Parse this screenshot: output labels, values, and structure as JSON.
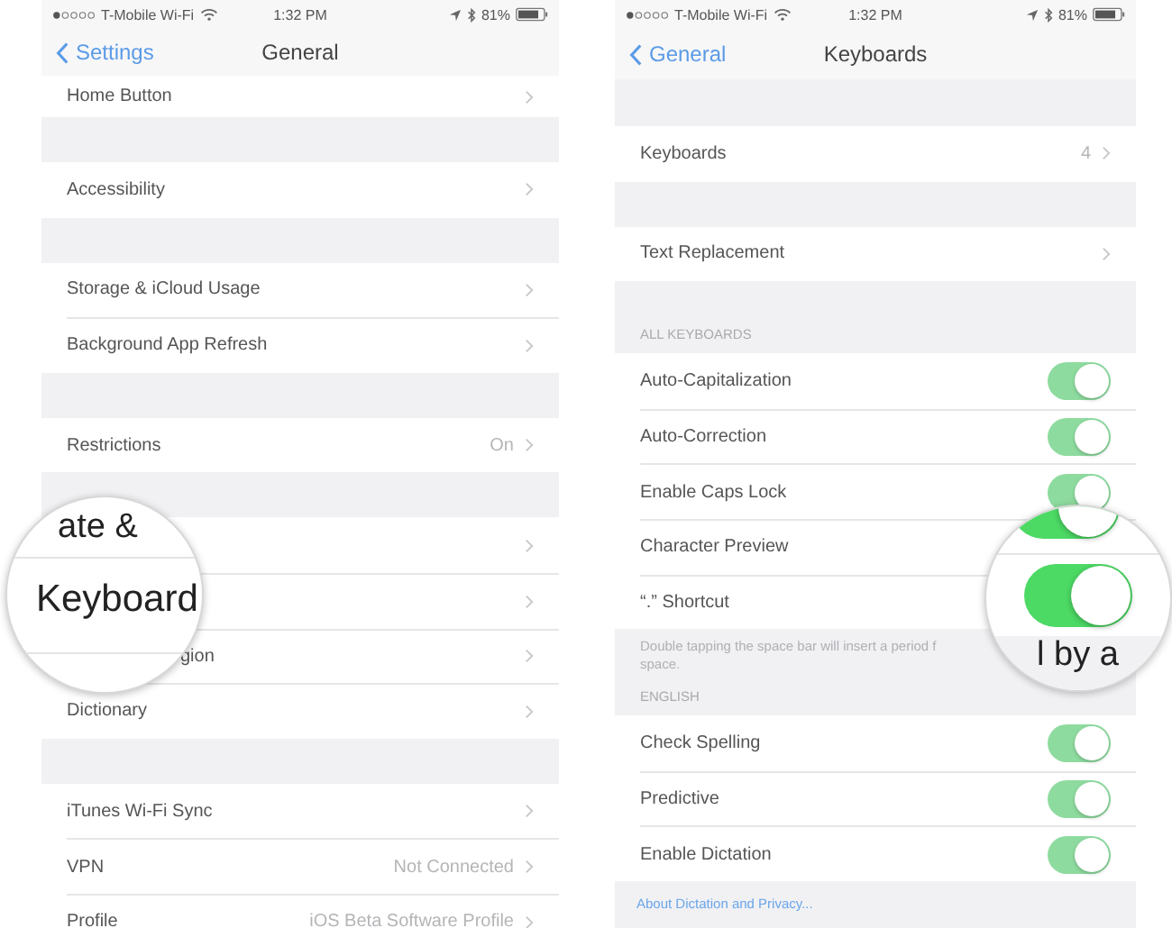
{
  "screens": [
    {
      "status_bar": {
        "carrier": "T-Mobile Wi-Fi",
        "time": "1:32 PM",
        "battery": "81%"
      },
      "nav": {
        "back": "Settings",
        "title": "General"
      },
      "sections": [
        {
          "rows": [
            {
              "label": "Home Button",
              "kind": "chevron"
            }
          ]
        },
        {
          "rows": [
            {
              "label": "Accessibility",
              "kind": "chevron"
            }
          ]
        },
        {
          "rows": [
            {
              "label": "Storage & iCloud Usage",
              "kind": "chevron"
            },
            {
              "label": "Background App Refresh",
              "kind": "chevron"
            }
          ]
        },
        {
          "rows": [
            {
              "label": "Restrictions",
              "value": "On",
              "kind": "chevron"
            }
          ]
        },
        {
          "rows": [
            {
              "kind": "covered"
            },
            {
              "kind": "covered"
            },
            {
              "label": "gion",
              "kind": "partial"
            },
            {
              "label": "Dictionary",
              "kind": "chevron"
            }
          ]
        },
        {
          "rows": [
            {
              "label": "iTunes Wi-Fi Sync",
              "kind": "chevron"
            },
            {
              "label": "VPN",
              "value": "Not Connected",
              "kind": "chevron"
            },
            {
              "label": "Profile",
              "value": "iOS Beta Software Profile",
              "kind": "chevron"
            }
          ]
        }
      ],
      "magnifier": {
        "kind": "text",
        "texts": [
          "ate &",
          "Keyboard"
        ]
      }
    },
    {
      "status_bar": {
        "carrier": "T-Mobile Wi-Fi",
        "time": "1:32 PM",
        "battery": "81%"
      },
      "nav": {
        "back": "General",
        "title": "Keyboards"
      },
      "sections": [
        {
          "rows": [
            {
              "label": "Keyboards",
              "value": "4",
              "kind": "chevron"
            }
          ]
        },
        {
          "rows": [
            {
              "label": "Text Replacement",
              "kind": "chevron"
            }
          ]
        },
        {
          "header": "ALL KEYBOARDS",
          "rows": [
            {
              "label": "Auto-Capitalization",
              "kind": "toggle",
              "on": true
            },
            {
              "label": "Auto-Correction",
              "kind": "toggle",
              "on": true
            },
            {
              "label": "Enable Caps Lock",
              "kind": "toggle",
              "on": true
            },
            {
              "label": "Character Preview",
              "kind": "magnified-toggle",
              "on": true
            },
            {
              "label": "“.” Shortcut",
              "kind": "magnified-toggle",
              "on": true
            }
          ],
          "footer": [
            "Double tapping the space bar will insert a period f",
            "space."
          ]
        },
        {
          "header": "ENGLISH",
          "rows": [
            {
              "label": "Check Spelling",
              "kind": "toggle",
              "on": true
            },
            {
              "label": "Predictive",
              "kind": "toggle",
              "on": true
            },
            {
              "label": "Enable Dictation",
              "kind": "toggle",
              "on": true
            }
          ],
          "link": "About Dictation and Privacy..."
        }
      ],
      "magnifier": {
        "kind": "toggle",
        "text": "l by a"
      }
    }
  ]
}
